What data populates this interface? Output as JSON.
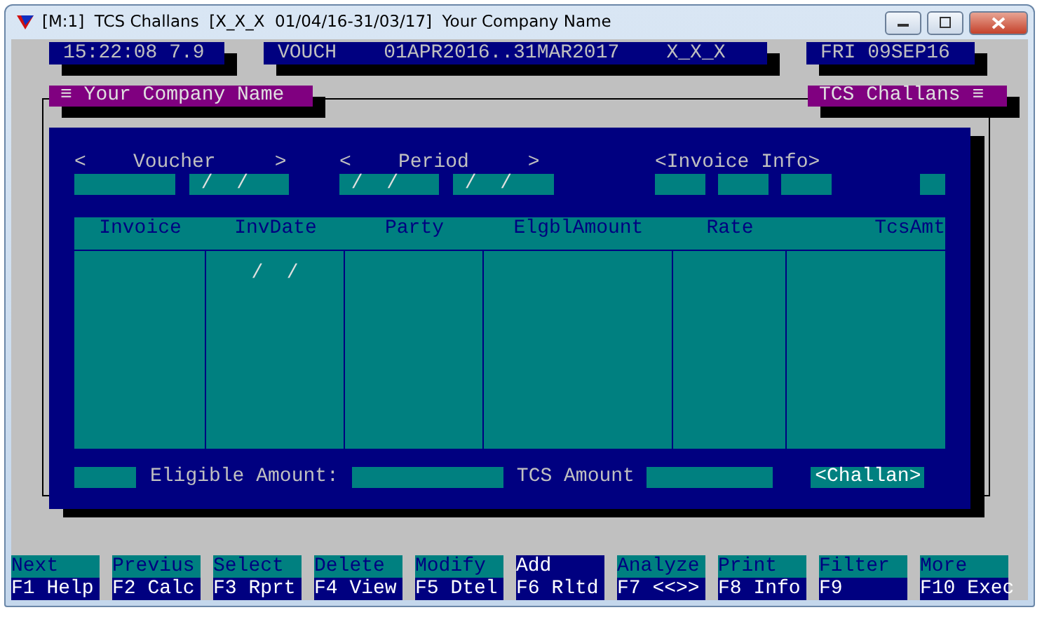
{
  "window": {
    "title": "[M:1]  TCS Challans  [X_X_X  01/04/16-31/03/17]  Your Company Name"
  },
  "status": [
    {
      "text": "15:22:08 7.9"
    },
    {
      "text": "VOUCH    01APR2016..31MAR2017    X_X_X"
    },
    {
      "text": "FRI 09SEP16"
    }
  ],
  "panel_titles": [
    "≡ Your Company Name",
    "TCS Challans ≡"
  ],
  "headings": [
    "<    Voucher     >",
    "<    Period     >",
    "<Invoice Info>"
  ],
  "fields": [
    {
      "kind": "blank"
    },
    {
      "kind": "date",
      "value": " /  /"
    },
    {
      "kind": "date",
      "value": " /  /"
    },
    {
      "kind": "date",
      "value": " /  /"
    },
    {
      "kind": "blank"
    },
    {
      "kind": "blank"
    },
    {
      "kind": "blank"
    },
    {
      "kind": "blank"
    }
  ],
  "table": {
    "columns": [
      "Invoice",
      "InvDate",
      "Party",
      "ElgblAmount",
      "Rate",
      "TcsAmt"
    ],
    "rows": [
      {
        "inv_date": "/  /"
      }
    ]
  },
  "footer": {
    "labels": [
      "Eligible Amount:",
      "TCS Amount"
    ],
    "button": "<Challan>"
  },
  "keys": [
    {
      "action": "Next",
      "fkey": "F1 Help",
      "selected": false
    },
    {
      "action": "Previus",
      "fkey": "F2 Calc",
      "selected": false
    },
    {
      "action": "Select",
      "fkey": "F3 Rprt",
      "selected": false
    },
    {
      "action": "Delete",
      "fkey": "F4 View",
      "selected": false
    },
    {
      "action": "Modify",
      "fkey": "F5 Dtel",
      "selected": false
    },
    {
      "action": "Add",
      "fkey": "F6 Rltd",
      "selected": true
    },
    {
      "action": "Analyze",
      "fkey": "F7 <<>>",
      "selected": false
    },
    {
      "action": "Print",
      "fkey": "F8 Info",
      "selected": false
    },
    {
      "action": "Filter",
      "fkey": "F9",
      "selected": false
    },
    {
      "action": "More",
      "fkey": "F10 Exec",
      "selected": false
    }
  ]
}
